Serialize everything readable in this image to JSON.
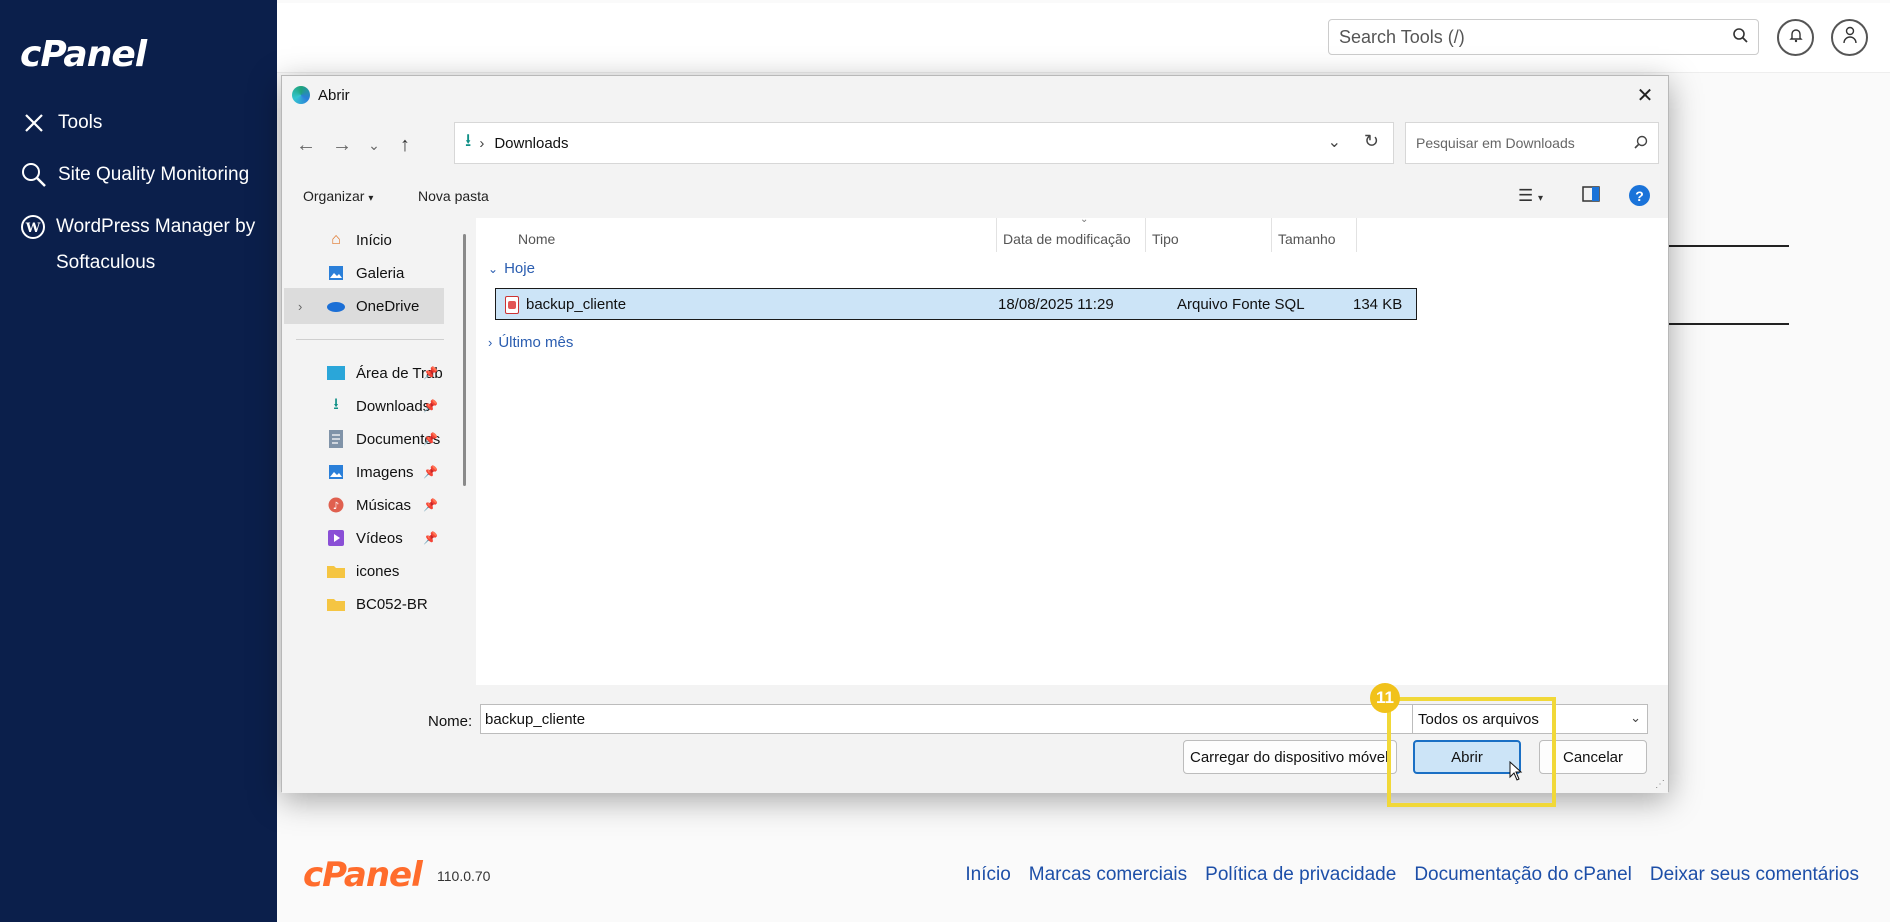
{
  "sidebar": {
    "logo": "cPanel",
    "items": [
      {
        "label": "Tools",
        "icon": "tools-icon"
      },
      {
        "label": "Site Quality Monitoring",
        "icon": "search-quality-icon"
      },
      {
        "label": "WordPress Manager by Softaculous",
        "icon": "wordpress-icon"
      }
    ]
  },
  "header": {
    "search_placeholder": "Search Tools (/)"
  },
  "footer": {
    "logo": "cPanel",
    "version": "110.0.70",
    "links": [
      "Início",
      "Marcas comerciais",
      "Política de privacidade",
      "Documentação do cPanel",
      "Deixar seus comentários"
    ]
  },
  "dialog": {
    "title": "Abrir",
    "address": "Downloads",
    "search_placeholder": "Pesquisar em Downloads",
    "toolbar": {
      "organize": "Organizar",
      "new_folder": "Nova pasta"
    },
    "nav_pane": [
      {
        "label": "Início",
        "icon": "home-icon",
        "pinned": false
      },
      {
        "label": "Galeria",
        "icon": "gallery-icon",
        "pinned": false
      },
      {
        "label": "OneDrive",
        "icon": "onedrive-icon",
        "pinned": false
      },
      {
        "label": "Área de Trab",
        "icon": "desktop-icon",
        "pinned": true
      },
      {
        "label": "Downloads",
        "icon": "download-icon",
        "pinned": true
      },
      {
        "label": "Documentos",
        "icon": "documents-icon",
        "pinned": true
      },
      {
        "label": "Imagens",
        "icon": "images-icon",
        "pinned": true
      },
      {
        "label": "Músicas",
        "icon": "music-icon",
        "pinned": true
      },
      {
        "label": "Vídeos",
        "icon": "videos-icon",
        "pinned": true
      },
      {
        "label": "icones",
        "icon": "folder-icon",
        "pinned": false
      },
      {
        "label": "BC052-BR",
        "icon": "folder-icon",
        "pinned": false
      }
    ],
    "columns": [
      "Nome",
      "Data de modificação",
      "Tipo",
      "Tamanho"
    ],
    "groups": [
      {
        "label": "Hoje",
        "expanded": true
      },
      {
        "label": "Último mês",
        "expanded": false
      }
    ],
    "files": [
      {
        "name": "backup_cliente",
        "modified": "18/08/2025 11:29",
        "type": "Arquivo Fonte SQL",
        "size": "134 KB"
      }
    ],
    "name_label": "Nome:",
    "name_value": "backup_cliente",
    "filter": "Todos os arquivos",
    "buttons": {
      "upload": "Carregar do dispositivo móvel",
      "open": "Abrir",
      "cancel": "Cancelar"
    }
  },
  "tutorial": {
    "step": "11",
    "highlight_color": "#f1d838"
  }
}
